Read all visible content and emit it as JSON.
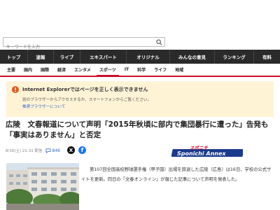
{
  "search": {
    "placeholder": "キーワードを入力"
  },
  "nav_main": {
    "tabs": [
      {
        "label": "トップ",
        "active": false
      },
      {
        "label": "速報",
        "active": false
      },
      {
        "label": "ライブ",
        "active": false
      },
      {
        "label": "エキスパート",
        "active": false
      },
      {
        "label": "オリジナル",
        "active": false
      },
      {
        "label": "みんなの意見",
        "active": false
      },
      {
        "label": "ランキング",
        "active": false
      },
      {
        "label": "有料",
        "active": false
      }
    ]
  },
  "nav_sub": {
    "items": [
      {
        "label": "主要",
        "active": false
      },
      {
        "label": "国内",
        "active": false
      },
      {
        "label": "国際",
        "active": false
      },
      {
        "label": "経済",
        "active": false
      },
      {
        "label": "エンタメ",
        "active": false
      },
      {
        "label": "スポーツ",
        "active": true
      },
      {
        "label": "IT",
        "active": false
      },
      {
        "label": "科学",
        "active": false
      },
      {
        "label": "ライフ",
        "active": false
      },
      {
        "label": "地域",
        "active": false
      }
    ]
  },
  "notice": {
    "title": "Internet Explorerではページを正しく表示できません",
    "text": "別のブラウザーからアクセスするか、スマートフォンからご覧ください。",
    "link": "推奨ブラウザーについて"
  },
  "article": {
    "headline": "広陵　文春報道について声明「2015年秋頃に部内で集団暴行に遭った」告発も「事実はありません」と否定",
    "date": "8/16(土) 21:31 配信",
    "comments": "846",
    "share_x": "X",
    "share_fb": "f",
    "source_logo_top": "スポニチ",
    "source_logo": "Sponichi Annex",
    "body": "第107回全国高校野球選手権（甲子園）出場を辞退した広陵（広島）は16日、学校の公式サイトを更新。同日の「文春オンライン」が報じた記事について声明を発表した。"
  },
  "colors": {
    "accent": "#c8102e",
    "nav_bg": "#2a2a2a",
    "notice_bg": "#fff3d6",
    "link": "#3366cc"
  }
}
